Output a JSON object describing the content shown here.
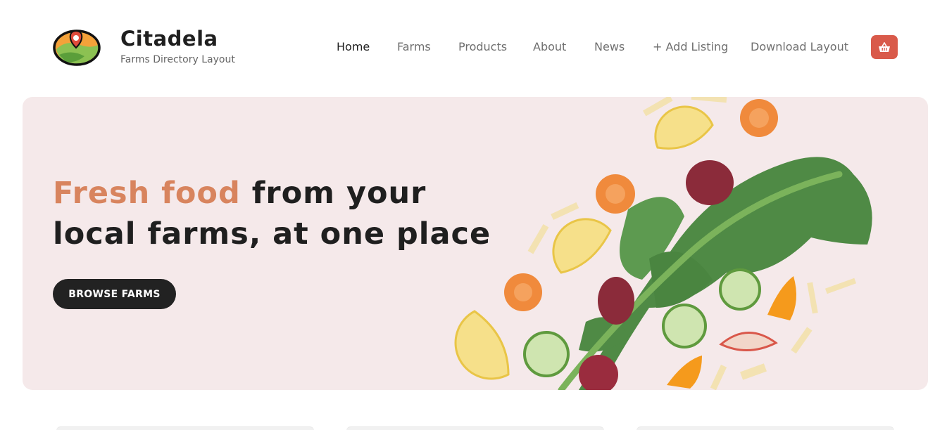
{
  "brand": {
    "name": "Citadela",
    "tagline": "Farms Directory Layout"
  },
  "nav": {
    "items": [
      {
        "label": "Home",
        "active": true
      },
      {
        "label": "Farms",
        "active": false
      },
      {
        "label": "Products",
        "active": false
      },
      {
        "label": "About",
        "active": false
      },
      {
        "label": "News",
        "active": false
      },
      {
        "label": "+ Add Listing",
        "active": false
      },
      {
        "label": "Download Layout",
        "active": false
      }
    ],
    "cart_icon": "shopping-basket-icon"
  },
  "hero": {
    "title_accent": "Fresh food",
    "title_rest_line1": " from your",
    "title_line2": "local farms, at one place",
    "button_label": "BROWSE FARMS",
    "image": "vegetables-kale-carrots-cucumber-lemon-beet"
  },
  "colors": {
    "accent": "#d8845e",
    "cart": "#d95a4a",
    "hero_bg": "#f5e9ea",
    "button_bg": "#222222"
  }
}
